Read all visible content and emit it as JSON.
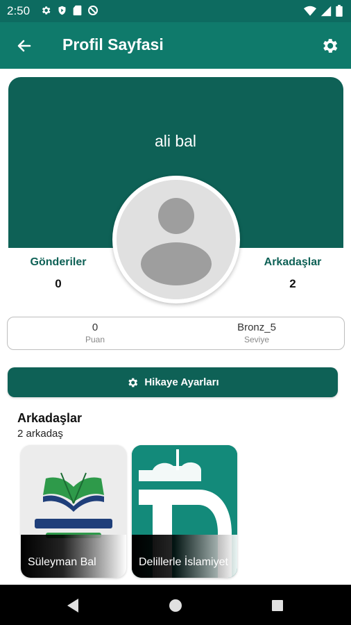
{
  "status_bar": {
    "time": "2:50"
  },
  "app_bar": {
    "title": "Profil Sayfasi",
    "back_icon": "arrow-left-icon",
    "settings_icon": "gear-icon"
  },
  "profile": {
    "name": "ali bal",
    "stats": {
      "posts_label": "Gönderiler",
      "posts_value": "0",
      "friends_label": "Arkadaşlar",
      "friends_value": "2"
    },
    "info": {
      "points_value": "0",
      "points_label": "Puan",
      "level_value": "Bronz_5",
      "level_label": "Seviye"
    }
  },
  "story_button": {
    "label": "Hikaye Ayarları",
    "icon": "gear-icon"
  },
  "friends": {
    "title": "Arkadaşlar",
    "count": "2 arkadaş",
    "items": [
      {
        "name": "Süleyman Bal"
      },
      {
        "name": "Delillerle İslamiyet"
      }
    ]
  },
  "colors": {
    "primary": "#0f7a6b",
    "primary_dark": "#0e6156",
    "statusbar": "#0d6b60"
  }
}
